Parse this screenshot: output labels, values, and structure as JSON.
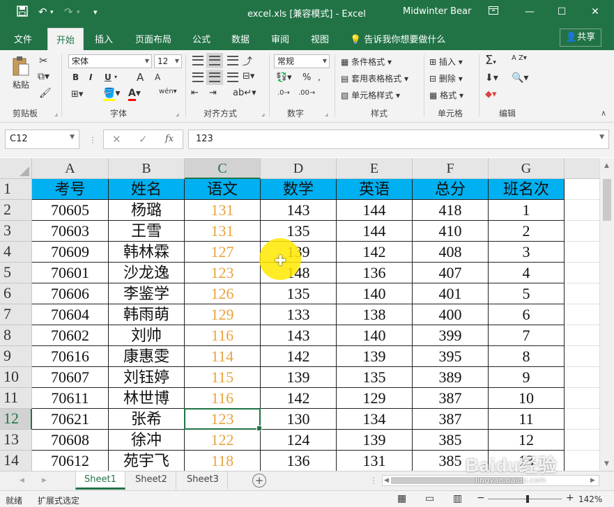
{
  "window": {
    "title": "excel.xls  [兼容模式]  -  Excel",
    "user": "Midwinter Bear",
    "save_icon": "save-icon",
    "undo_icon": "undo-icon",
    "redo_icon": "redo-icon",
    "accent": "#217346"
  },
  "tabs": [
    "文件",
    "开始",
    "插入",
    "页面布局",
    "公式",
    "数据",
    "审阅",
    "视图"
  ],
  "tellme": "告诉我你想要做什么",
  "share": "共享",
  "ribbon": {
    "clipboard": {
      "paste": "粘贴",
      "label": "剪贴板"
    },
    "font": {
      "name": "宋体",
      "size": "12",
      "label": "字体",
      "bold": "B",
      "italic": "I",
      "underline": "U",
      "grow": "A",
      "shrink": "A",
      "wen": "wén"
    },
    "align": {
      "label": "对齐方式"
    },
    "number": {
      "format": "常规",
      "label": "数字",
      "percent": "%"
    },
    "styles": {
      "cond": "条件格式",
      "table": "套用表格格式",
      "cell": "单元格样式",
      "label": "样式"
    },
    "cells": {
      "insert": "插入",
      "delete": "删除",
      "format": "格式",
      "label": "单元格"
    },
    "edit": {
      "label": "编辑",
      "sum": "Σ",
      "sort": "A Z"
    }
  },
  "formula": {
    "namebox": "C12",
    "fx": "fx",
    "value": "123"
  },
  "columns": [
    "A",
    "B",
    "C",
    "D",
    "E",
    "F",
    "G"
  ],
  "selected_column": "C",
  "selected_row": 12,
  "rows": [
    {
      "n": "1",
      "cells": [
        "考号",
        "姓名",
        "语文",
        "数学",
        "英语",
        "总分",
        "班名次"
      ]
    },
    {
      "n": "2",
      "cells": [
        "70605",
        "杨璐",
        "131",
        "143",
        "144",
        "418",
        "1"
      ]
    },
    {
      "n": "3",
      "cells": [
        "70603",
        "王雪",
        "131",
        "135",
        "144",
        "410",
        "2"
      ]
    },
    {
      "n": "4",
      "cells": [
        "70609",
        "韩林霖",
        "127",
        "139",
        "142",
        "408",
        "3"
      ]
    },
    {
      "n": "5",
      "cells": [
        "70601",
        "沙龙逸",
        "123",
        "148",
        "136",
        "407",
        "4"
      ]
    },
    {
      "n": "6",
      "cells": [
        "70606",
        "李鉴学",
        "126",
        "135",
        "140",
        "401",
        "5"
      ]
    },
    {
      "n": "7",
      "cells": [
        "70604",
        "韩雨萌",
        "129",
        "133",
        "138",
        "400",
        "6"
      ]
    },
    {
      "n": "8",
      "cells": [
        "70602",
        "刘帅",
        "116",
        "143",
        "140",
        "399",
        "7"
      ]
    },
    {
      "n": "9",
      "cells": [
        "70616",
        "康惠雯",
        "114",
        "142",
        "139",
        "395",
        "8"
      ]
    },
    {
      "n": "10",
      "cells": [
        "70607",
        "刘钰婷",
        "115",
        "139",
        "135",
        "389",
        "9"
      ]
    },
    {
      "n": "11",
      "cells": [
        "70611",
        "林世博",
        "116",
        "142",
        "129",
        "387",
        "10"
      ]
    },
    {
      "n": "12",
      "cells": [
        "70621",
        "张希",
        "123",
        "130",
        "134",
        "387",
        "11"
      ]
    },
    {
      "n": "13",
      "cells": [
        "70608",
        "徐冲",
        "122",
        "124",
        "139",
        "385",
        "12"
      ]
    },
    {
      "n": "14",
      "cells": [
        "70612",
        "苑宇飞",
        "118",
        "136",
        "131",
        "385",
        "13"
      ]
    }
  ],
  "colors": {
    "header_fill": "#00b0f0",
    "chinese_score": "#e8a33d"
  },
  "sheets": [
    "Sheet1",
    "Sheet2",
    "Sheet3"
  ],
  "active_sheet": "Sheet1",
  "status": {
    "ready": "就绪",
    "mode": "扩展式选定",
    "zoom": "142%"
  },
  "watermark": {
    "logo": "Baidu经验",
    "url": "jingyan.baidu.com"
  }
}
